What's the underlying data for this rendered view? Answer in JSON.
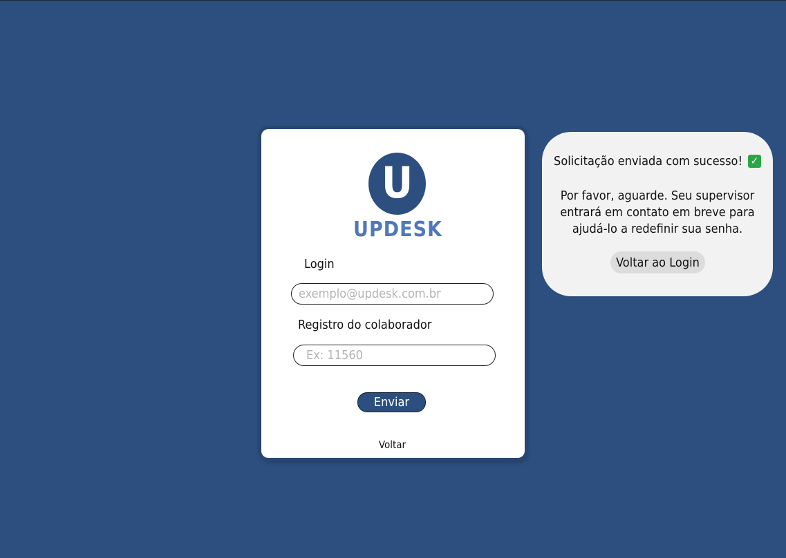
{
  "brand": {
    "logo_letter": "U",
    "name": "UPDESK"
  },
  "form": {
    "login_label": "Login",
    "login_placeholder": "exemplo@updesk.com.br",
    "login_value": "",
    "registro_label": "Registro do colaborador",
    "registro_placeholder": "Ex: 11560",
    "registro_value": "",
    "submit_label": "Enviar",
    "back_link": "Voltar"
  },
  "toast": {
    "title": "Solicitação enviada com sucesso!",
    "icon": "check-mark-button-icon",
    "message_lines": [
      "Por favor, aguarde. Seu supervisor",
      "entrará em contato em breve para",
      "ajudá-lo a redefinir sua senha."
    ],
    "button_label": "Voltar ao Login"
  },
  "colors": {
    "background": "#2c4f80",
    "brand_text": "#5077ba",
    "toast_bg": "#f2f2f2",
    "check_green": "#29a744"
  }
}
